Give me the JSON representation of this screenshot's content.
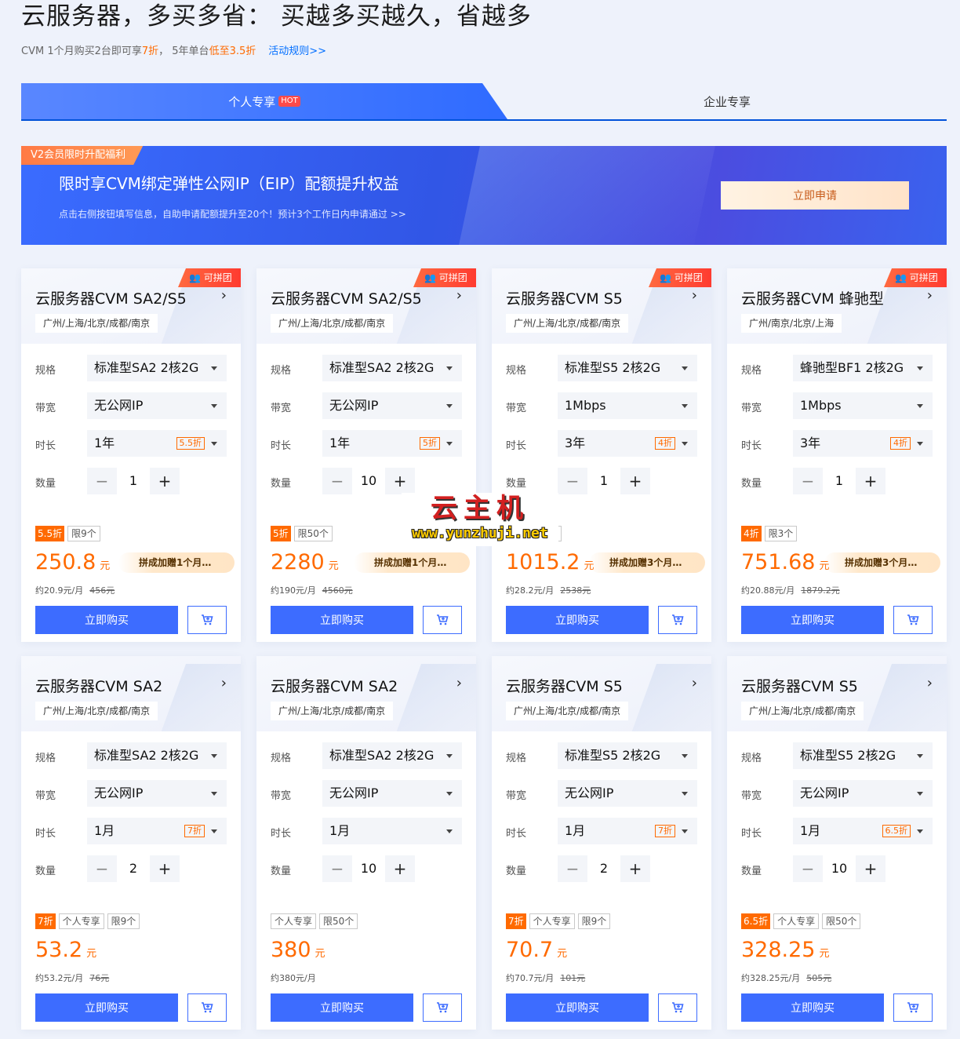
{
  "header": {
    "title": "云服务器，多买多省： 买越多买越久，省越多",
    "sub_a": "CVM 1个月购买2台即可享 ",
    "sub_b": "7折",
    "sub_c": "， 5年单台 ",
    "sub_d": "低至3.5折",
    "rules_link": "活动规则>>"
  },
  "tabs": {
    "personal": "个人专享",
    "hot": "HOT",
    "enterprise": "企业专享"
  },
  "banner": {
    "tag": "V2会员限时升配福利",
    "title": "限时享CVM绑定弹性公网IP（EIP）配额提升权益",
    "subtitle": "点击右侧按钮填写信息，自助申请配额提升至20个！预计3个工作日内申请通过 >>",
    "apply": "立即申请"
  },
  "labels": {
    "spec": "规格",
    "bandwidth": "带宽",
    "duration": "时长",
    "quantity": "数量",
    "buy": "立即购买",
    "group_badge": "可拼团",
    "yuan": "元"
  },
  "cards": [
    {
      "title": "云服务器CVM SA2/S5",
      "region": "广州/上海/北京/成都/南京",
      "spec": "标准型SA2 2核2G",
      "bandwidth": "无公网IP",
      "duration": "1年",
      "duration_tag": "5.5折",
      "quantity": "1",
      "tags": [
        "5.5折",
        "限9个"
      ],
      "price": "250.8",
      "promo": "拼成加赠1个月时长",
      "monthly": "约20.9元/月",
      "original": "456元"
    },
    {
      "title": "云服务器CVM SA2/S5",
      "region": "广州/上海/北京/成都/南京",
      "spec": "标准型SA2 2核2G",
      "bandwidth": "无公网IP",
      "duration": "1年",
      "duration_tag": "5折",
      "quantity": "10",
      "tags": [
        "5折",
        "限50个"
      ],
      "price": "2280",
      "promo": "拼成加赠1个月时长",
      "monthly": "约190元/月",
      "original": "4560元"
    },
    {
      "title": "云服务器CVM S5",
      "region": "广州/上海/北京/成都/南京",
      "spec": "标准型S5 2核2G",
      "bandwidth": "1Mbps",
      "duration": "3年",
      "duration_tag": "4折",
      "quantity": "1",
      "tags": [
        "4折",
        "限3个"
      ],
      "price": "1015.2",
      "promo": "拼成加赠3个月时长",
      "monthly": "约28.2元/月",
      "original": "2538元"
    },
    {
      "title": "云服务器CVM 蜂驰型",
      "region": "广州/南京/北京/上海",
      "spec": "蜂驰型BF1 2核2G",
      "bandwidth": "1Mbps",
      "duration": "3年",
      "duration_tag": "4折",
      "quantity": "1",
      "tags": [
        "4折",
        "限3个"
      ],
      "price": "751.68",
      "promo": "拼成加赠3个月时长",
      "monthly": "约20.88元/月",
      "original": "1879.2元"
    },
    {
      "title": "云服务器CVM SA2",
      "region": "广州/上海/北京/成都/南京",
      "spec": "标准型SA2 2核2G",
      "bandwidth": "无公网IP",
      "duration": "1月",
      "duration_tag": "7折",
      "quantity": "2",
      "tags": [
        "7折",
        "个人专享",
        "限9个"
      ],
      "price": "53.2",
      "promo": "",
      "monthly": "约53.2元/月",
      "original": "76元"
    },
    {
      "title": "云服务器CVM SA2",
      "region": "广州/上海/北京/成都/南京",
      "spec": "标准型SA2 2核2G",
      "bandwidth": "无公网IP",
      "duration": "1月",
      "duration_tag": "",
      "quantity": "10",
      "tags": [
        "个人专享",
        "限50个"
      ],
      "price": "380",
      "promo": "",
      "monthly": "约380元/月",
      "original": ""
    },
    {
      "title": "云服务器CVM S5",
      "region": "广州/上海/北京/成都/南京",
      "spec": "标准型S5 2核2G",
      "bandwidth": "无公网IP",
      "duration": "1月",
      "duration_tag": "7折",
      "quantity": "2",
      "tags": [
        "7折",
        "个人专享",
        "限9个"
      ],
      "price": "70.7",
      "promo": "",
      "monthly": "约70.7元/月",
      "original": "101元"
    },
    {
      "title": "云服务器CVM S5",
      "region": "广州/上海/北京/成都/南京",
      "spec": "标准型S5 2核2G",
      "bandwidth": "无公网IP",
      "duration": "1月",
      "duration_tag": "6.5折",
      "quantity": "10",
      "tags": [
        "6.5折",
        "个人专享",
        "限50个"
      ],
      "price": "328.25",
      "promo": "",
      "monthly": "约328.25元/月",
      "original": "505元"
    }
  ],
  "watermark": {
    "line1": "云主机",
    "line2": "www.yunzhuji.net"
  }
}
